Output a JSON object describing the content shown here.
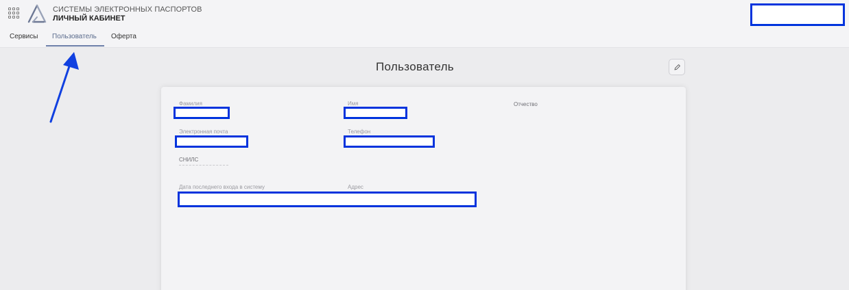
{
  "header": {
    "brand_line1": "СИСТЕМЫ ЭЛЕКТРОННЫХ ПАСПОРТОВ",
    "brand_line2": "ЛИЧНЫЙ КАБИНЕТ",
    "apps_icon": "grid-icon",
    "logo_icon": "triangle-logo-icon"
  },
  "tabs": [
    {
      "label": "Сервисы",
      "active": false
    },
    {
      "label": "Пользователь",
      "active": true
    },
    {
      "label": "Оферта",
      "active": false
    }
  ],
  "page": {
    "title": "Пользователь",
    "edit_icon": "pencil-icon"
  },
  "fields": {
    "last_name": {
      "label": "Фамилия"
    },
    "first_name": {
      "label": "Имя"
    },
    "middle_name": {
      "label": "Отчество"
    },
    "email": {
      "label": "Электронная почта"
    },
    "phone": {
      "label": "Телефон"
    },
    "snils": {
      "label": "СНИЛС"
    },
    "last_login": {
      "label": "Дата последнего входа в систему"
    },
    "address": {
      "label": "Адрес"
    }
  },
  "colors": {
    "accent": "#6c7fa8",
    "redaction_border": "#0033dd",
    "annotation_arrow": "#1040e0"
  }
}
